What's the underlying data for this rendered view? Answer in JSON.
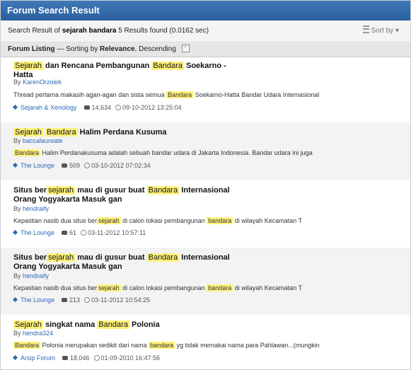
{
  "header": {
    "title": "Forum Search Result"
  },
  "summary": {
    "prefix": "Search Result of",
    "query": "sejarah bandara",
    "count_text": "5 Results found (0.0162 sec)",
    "sort_label": "Sort by"
  },
  "listing": {
    "label": "Forum Listing",
    "sorting_prefix": "— Sorting by",
    "sort_field": "Relevance",
    "sort_order": ", Descending",
    "collapse_glyph": "^"
  },
  "results": [
    {
      "title_parts": [
        {
          "t": "Sejarah",
          "hl": true
        },
        {
          "t": " dan Rencana Pembangunan ",
          "hl": false
        },
        {
          "t": "Bandara",
          "hl": true
        },
        {
          "t": " Soekarno -",
          "hl": false
        },
        {
          "t": "\nHatta",
          "hl": false
        }
      ],
      "by": "By",
      "author": "KarenOrzolek",
      "snippet_parts": [
        {
          "t": "Thread pertama makasih agan-agan dan sista semua ",
          "hl": false
        },
        {
          "t": "Bandara",
          "hl": true
        },
        {
          "t": " Soekarno-Hatta Bandar Udara Internasional",
          "hl": false
        }
      ],
      "forum": "Sejarah & Xenology",
      "replies": "14,634",
      "date": "09-10-2012 13:25:04"
    },
    {
      "title_parts": [
        {
          "t": "Sejarah",
          "hl": true
        },
        {
          "t": " ",
          "hl": false
        },
        {
          "t": "Bandara",
          "hl": true
        },
        {
          "t": " Halim Perdana Kusuma",
          "hl": false
        }
      ],
      "by": "By",
      "author": "baccalaureate",
      "snippet_parts": [
        {
          "t": "Bandara",
          "hl": true
        },
        {
          "t": " Halim Perdanakusuma adalah sebuah bandar udara di Jakarta Indonesia. Bandar udara ini juga",
          "hl": false
        }
      ],
      "forum": "The Lounge",
      "replies": "509",
      "date": "03-10-2012 07:02:34"
    },
    {
      "title_parts": [
        {
          "t": "Situs ber",
          "hl": false
        },
        {
          "t": "sejarah",
          "hl": true
        },
        {
          "t": " mau di gusur buat ",
          "hl": false
        },
        {
          "t": "Bandara",
          "hl": true
        },
        {
          "t": " Internasional",
          "hl": false
        },
        {
          "t": "\nOrang Yogyakarta Masuk gan",
          "hl": false
        }
      ],
      "by": "By",
      "author": "hendraify",
      "snippet_parts": [
        {
          "t": "Kepastian nasib dua situs ber",
          "hl": false
        },
        {
          "t": "sejarah",
          "hl": true
        },
        {
          "t": " di calon lokasi pembangunan ",
          "hl": false
        },
        {
          "t": "bandara",
          "hl": true
        },
        {
          "t": " di wilayah Kecamatan T",
          "hl": false
        }
      ],
      "forum": "The Lounge",
      "replies": "61",
      "date": "03-11-2012 10:57:11"
    },
    {
      "title_parts": [
        {
          "t": "Situs ber",
          "hl": false
        },
        {
          "t": "sejarah",
          "hl": true
        },
        {
          "t": " mau di gusur buat ",
          "hl": false
        },
        {
          "t": "Bandara",
          "hl": true
        },
        {
          "t": " Internasional",
          "hl": false
        },
        {
          "t": "\nOrang Yogyakarta Masuk gan",
          "hl": false
        }
      ],
      "by": "By",
      "author": "hendraify",
      "snippet_parts": [
        {
          "t": "Kepastian nasib dua situs ber",
          "hl": false
        },
        {
          "t": "sejarah",
          "hl": true
        },
        {
          "t": " di calon lokasi pembangunan ",
          "hl": false
        },
        {
          "t": "bandara",
          "hl": true
        },
        {
          "t": " di wilayah Kecamatan T",
          "hl": false
        }
      ],
      "forum": "The Lounge",
      "replies": "213",
      "date": "03-11-2012 10:54:25"
    },
    {
      "title_parts": [
        {
          "t": "Sejarah",
          "hl": true
        },
        {
          "t": " singkat nama ",
          "hl": false
        },
        {
          "t": "Bandara",
          "hl": true
        },
        {
          "t": " Polonia",
          "hl": false
        }
      ],
      "by": "By",
      "author": "hendra324",
      "snippet_parts": [
        {
          "t": "Bandara",
          "hl": true
        },
        {
          "t": " Polonia merupakan sedikit dari nama ",
          "hl": false
        },
        {
          "t": "bandara",
          "hl": true
        },
        {
          "t": " yg tidak memakai nama para Pahlawan...(mungkin",
          "hl": false
        }
      ],
      "forum": "Arsip Forum",
      "replies": "18,046",
      "date": "01-09-2010 16:47:56"
    }
  ]
}
